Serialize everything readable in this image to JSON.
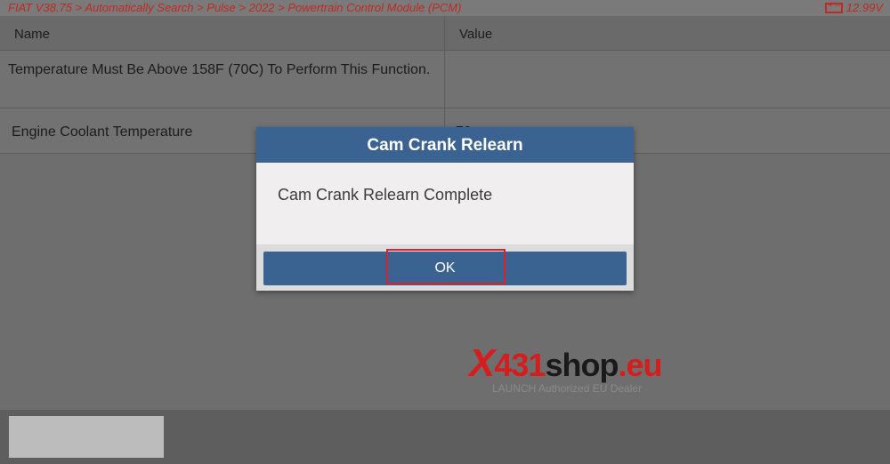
{
  "header": {
    "breadcrumb": "FIAT V38.75 > Automatically Search > Pulse > 2022 > Powertrain Control Module (PCM)",
    "voltage": "12.99V",
    "battery_icon": "battery-icon",
    "accent_color": "#c02a22"
  },
  "table": {
    "columns": [
      "Name",
      "Value"
    ],
    "rows": [
      {
        "name": "Temperature Must Be Above 158F (70C) To Perform This Function.",
        "value": ""
      },
      {
        "name": "Engine Coolant Temperature",
        "value": "70"
      }
    ]
  },
  "dialog": {
    "title": "Cam Crank Relearn",
    "message": "Cam Crank Relearn Complete",
    "ok_label": "OK",
    "title_color": "#3b6392"
  },
  "watermark": {
    "logo_x": "X",
    "logo_num": "431",
    "logo_word": "shop",
    "logo_domain": ".eu",
    "tagline": "LAUNCH Authorized EU Dealer"
  }
}
